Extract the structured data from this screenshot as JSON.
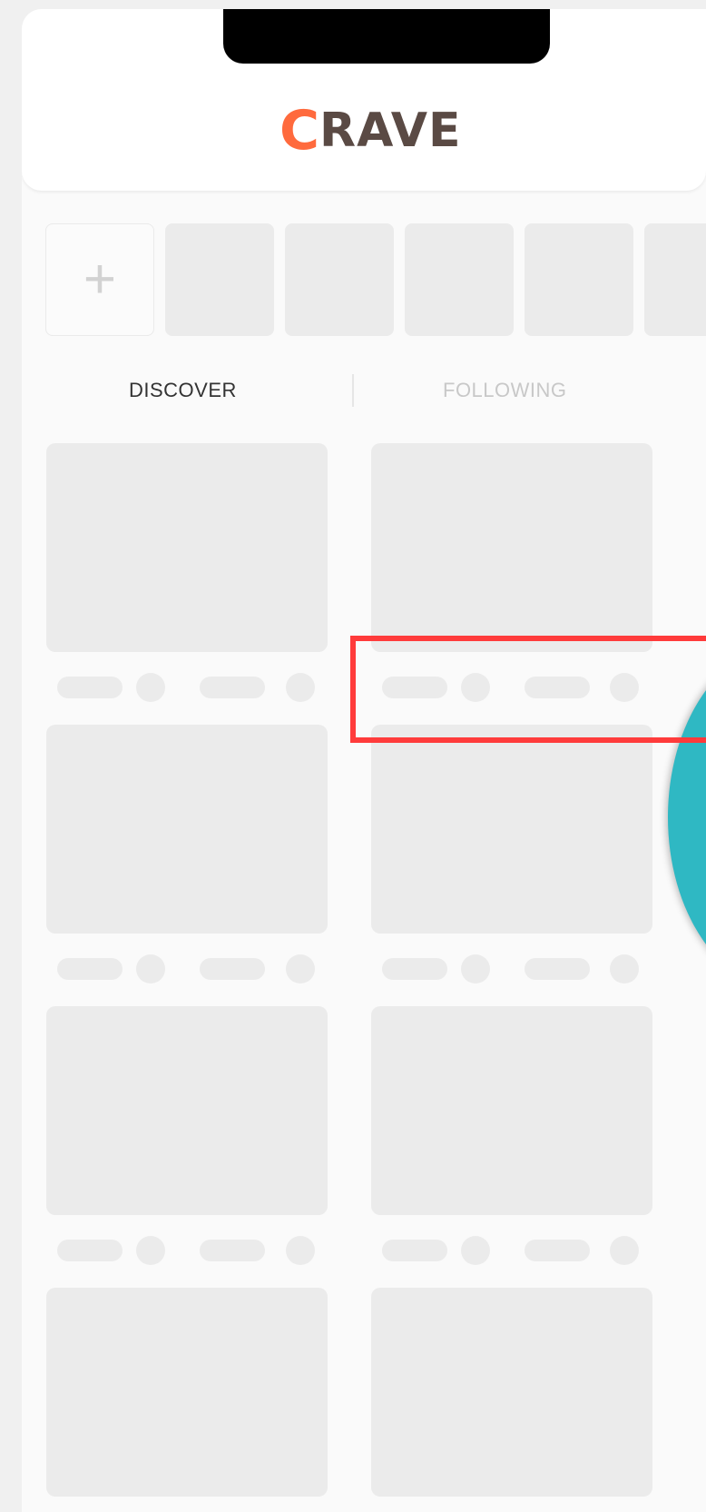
{
  "app": {
    "logo": {
      "first_letter": "C",
      "rest": "RAVE",
      "accent_color": "#ff6a3d",
      "text_color": "#5a4a44"
    }
  },
  "stories": {
    "add_icon": "plus-icon",
    "add_symbol": "+",
    "placeholder_count": 5
  },
  "tabs": [
    {
      "label": "DISCOVER",
      "active": true
    },
    {
      "label": "FOLLOWING",
      "active": false
    }
  ],
  "feed": {
    "state": "loading-skeleton",
    "rows": 4,
    "columns": 2
  },
  "colors": {
    "skeleton": "#ebebeb",
    "highlight": "#ff3b3b",
    "fab": "#2fb8c3"
  }
}
